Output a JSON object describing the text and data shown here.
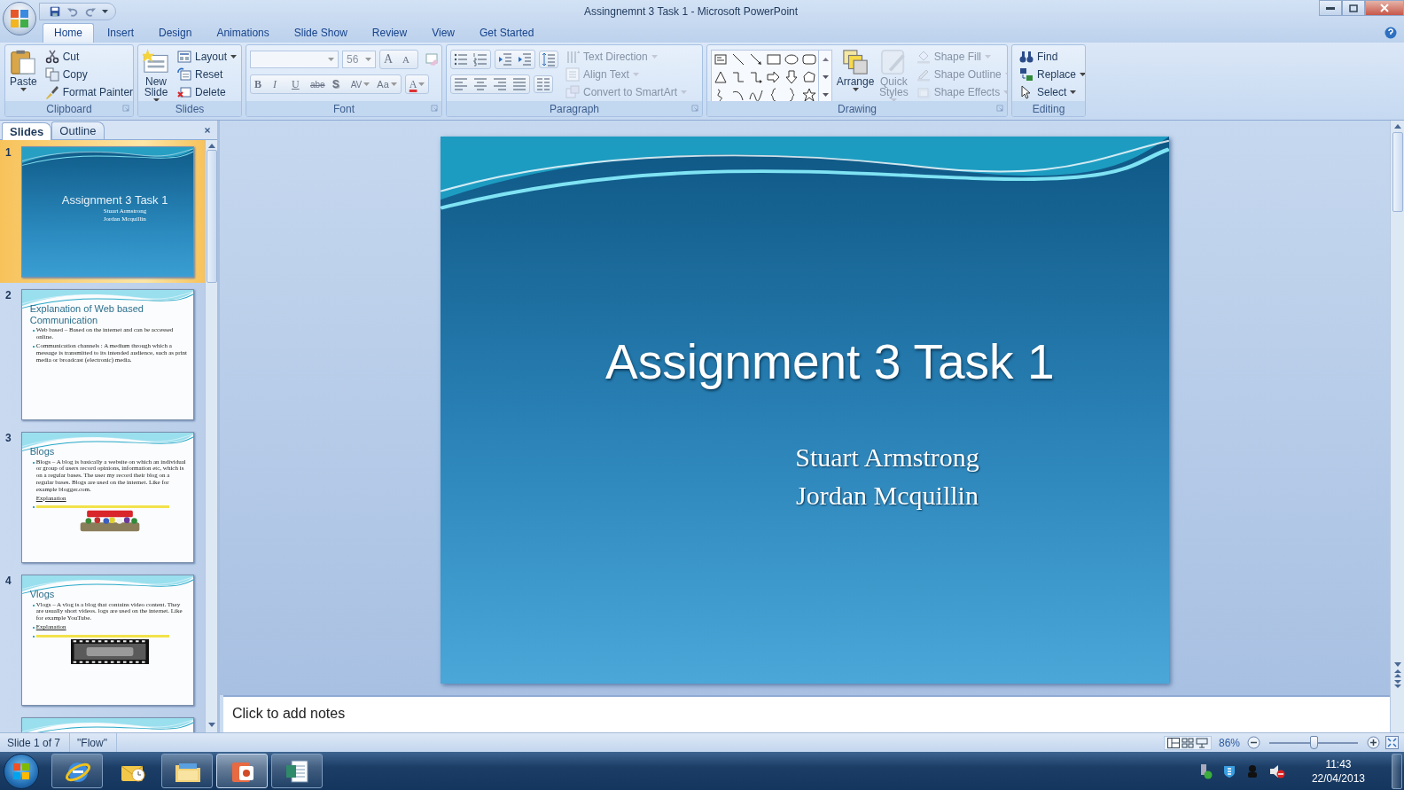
{
  "window": {
    "title": "Assingnemnt 3 Task 1  -  Microsoft PowerPoint"
  },
  "ribbon_tabs": [
    {
      "label": "Home",
      "selected": true
    },
    {
      "label": "Insert",
      "selected": false
    },
    {
      "label": "Design",
      "selected": false
    },
    {
      "label": "Animations",
      "selected": false
    },
    {
      "label": "Slide Show",
      "selected": false
    },
    {
      "label": "Review",
      "selected": false
    },
    {
      "label": "View",
      "selected": false
    },
    {
      "label": "Get Started",
      "selected": false
    }
  ],
  "ribbon_groups": [
    {
      "label": "Clipboard",
      "kind": "clipboard",
      "items": [
        {
          "label": "Paste",
          "disabled": false
        },
        {
          "label": "Cut",
          "disabled": false
        },
        {
          "label": "Copy",
          "disabled": false
        },
        {
          "label": "Format Painter",
          "disabled": false
        }
      ]
    },
    {
      "label": "Slides",
      "kind": "slides",
      "items": [
        {
          "label": "New Slide",
          "disabled": false
        },
        {
          "label": "Layout",
          "disabled": false
        },
        {
          "label": "Reset",
          "disabled": false
        },
        {
          "label": "Delete",
          "disabled": false
        }
      ]
    },
    {
      "label": "Font",
      "kind": "font",
      "font_size": "56",
      "buttons": [
        "A",
        "A",
        "B",
        "I",
        "U",
        "abe",
        "S",
        "AV",
        "Aa",
        "A"
      ]
    },
    {
      "label": "Paragraph",
      "kind": "paragraph",
      "items": [
        {
          "label": "Text Direction",
          "disabled": true
        },
        {
          "label": "Align Text",
          "disabled": true
        },
        {
          "label": "Convert to SmartArt",
          "disabled": true
        }
      ]
    },
    {
      "label": "Drawing",
      "kind": "drawing",
      "items": [
        {
          "label": "Arrange",
          "disabled": false
        },
        {
          "label": "Quick Styles",
          "disabled": true
        },
        {
          "label": "Shape Fill",
          "disabled": true
        },
        {
          "label": "Shape Outline",
          "disabled": true
        },
        {
          "label": "Shape Effects",
          "disabled": true
        }
      ]
    },
    {
      "label": "Editing",
      "kind": "editing",
      "items": [
        {
          "label": "Find",
          "disabled": false
        },
        {
          "label": "Replace",
          "disabled": false
        },
        {
          "label": "Select",
          "disabled": false
        }
      ]
    }
  ],
  "slides_pane": {
    "tabs": [
      {
        "label": "Slides",
        "selected": true
      },
      {
        "label": "Outline",
        "selected": false
      }
    ],
    "thumbnails": [
      {
        "number": "1",
        "selected": true,
        "kind": "title",
        "title": "Assignment 3 Task 1",
        "lines": [
          "Stuart Armstrong",
          "Jordan Mcquillin"
        ]
      },
      {
        "number": "2",
        "selected": false,
        "kind": "content",
        "title": "Explanation of Web based Communication",
        "items": [
          {
            "kind": "bullet",
            "text": "Web based – Based on the internet and can be accessed online."
          },
          {
            "kind": "bullet",
            "text": "Communication channels  : A medium through which a message is transmitted  to its intended audience, such as print media or broadcast (electronic)  media."
          }
        ]
      },
      {
        "number": "3",
        "selected": false,
        "kind": "content",
        "title": "Blogs",
        "items": [
          {
            "kind": "bullet",
            "text": "Blogs – A blog is basically a website on which an individual or group of users record opinions, information etc, which is on a regular bases. The user my record their blog on a regular bases. Blogs are used on the internet.  Like for example blogger.com."
          },
          {
            "kind": "heading",
            "text": "Explanation"
          },
          {
            "kind": "link"
          },
          {
            "kind": "picture"
          }
        ]
      },
      {
        "number": "4",
        "selected": false,
        "kind": "content",
        "title": "Vlogs",
        "items": [
          {
            "kind": "bullet",
            "text": "Vlogs – A vlog is a blog that contains video content. They are usually short videos. logs are used on the internet.  Like for example YouTube."
          },
          {
            "kind": "bullet_heading",
            "text": "Explanation"
          },
          {
            "kind": "link"
          },
          {
            "kind": "picture"
          }
        ]
      },
      {
        "selected": false,
        "kind": "content"
      }
    ]
  },
  "editor": {
    "slide": {
      "title": "Assignment 3 Task 1",
      "subtitle": [
        "Stuart Armstrong",
        "Jordan Mcquillin"
      ]
    },
    "notes": {
      "placeholder": "Click to add notes"
    }
  },
  "status_bar": {
    "slide_info": "Slide 1 of 7",
    "theme": "\"Flow\"",
    "zoom": "86%",
    "zoom_slider": {
      "level": 0.5
    }
  },
  "taskbar": {
    "apps": [
      {
        "running": true,
        "selected": false
      },
      {
        "running": false,
        "selected": false
      },
      {
        "running": true,
        "selected": false
      },
      {
        "running": true,
        "selected": true
      },
      {
        "running": true,
        "selected": false
      }
    ],
    "clock": {
      "time": "11:43",
      "date": "22/04/2013"
    }
  }
}
